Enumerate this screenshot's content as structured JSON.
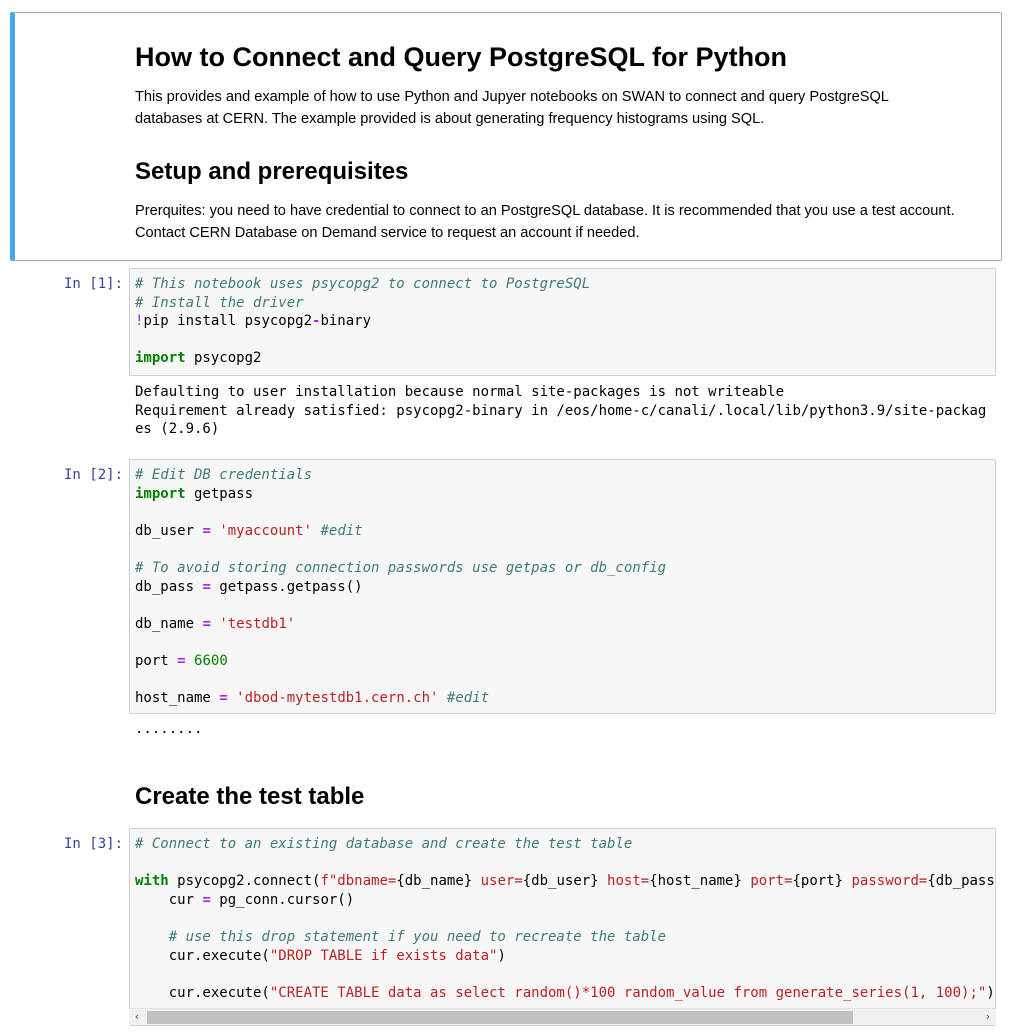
{
  "markdown": {
    "title": "How to Connect and Query PostgreSQL for Python",
    "intro": "This provides and example of how to use Python and Jupyer notebooks on SWAN to connect and query PostgreSQL databases at CERN. The example provided is about generating frequency histograms using SQL.",
    "setup_heading": "Setup and prerequisites",
    "setup_text": "Prerquites: you need to have credential to connect to an PostgreSQL database. It is recommended that you use a test account. Contact CERN Database on Demand service to request an account if needed."
  },
  "cells": {
    "cell1": {
      "prompt": "In [1]:",
      "line1": "# This notebook uses psycopg2 to connect to PostgreSQL",
      "line2": "# Install the driver",
      "line3_bang": "!",
      "line3_rest": "pip install psycopg2",
      "line3_minus": "-",
      "line3_end": "binary",
      "line5_kw": "import",
      "line5_rest": " psycopg2",
      "output": "Defaulting to user installation because normal site-packages is not writeable\nRequirement already satisfied: psycopg2-binary in /eos/home-c/canali/.local/lib/python3.9/site-packag\nes (2.9.6)"
    },
    "cell2": {
      "prompt": "In [2]:",
      "c1": "# Edit DB credentials",
      "import_kw": "import",
      "import_rest": " getpass",
      "db_user_name": "db_user ",
      "db_user_val": "'myaccount'",
      "db_user_comment": "#edit",
      "c2": "# To avoid storing connection passwords use getpas or db_config",
      "db_pass_name": "db_pass ",
      "db_pass_val": " getpass.getpass()",
      "db_name_name": "db_name ",
      "db_name_val": "'testdb1'",
      "port_name": "port ",
      "port_val": "6600",
      "host_name_name": "host_name ",
      "host_name_val": "'dbod-mytestdb1.cern.ch'",
      "host_comment": "#edit",
      "eq": "=",
      "output": "........"
    },
    "heading2": "Create the test table",
    "cell3": {
      "prompt": "In [3]:",
      "c1": "# Connect to an existing database and create the test table",
      "with_kw": "with",
      "with_rest1": " psycopg2.connect(",
      "with_f": "f",
      "with_s1": "\"dbname=",
      "with_v1": "{db_name}",
      "with_s2": " user=",
      "with_v2": "{db_user}",
      "with_s3": " host=",
      "with_v3": "{host_name}",
      "with_s4": " port=",
      "with_v4": "{port}",
      "with_s5": " password=",
      "with_v5": "{db_pass}",
      "cur_line_a": "    cur ",
      "eq": "=",
      "cur_line_b": " pg_conn.cursor()",
      "c2": "    # use this drop statement if you need to recreate the table",
      "exec1_a": "    cur.execute(",
      "exec1_s": "\"DROP TABLE if exists data\"",
      "exec1_b": ")",
      "exec2_a": "    cur.execute(",
      "exec2_s": "\"CREATE TABLE data as select random()*100 random_value from generate_series(1, 100);\"",
      "exec2_b": ")"
    }
  },
  "scrollbar": {
    "left_arrow": "‹",
    "right_arrow": "›",
    "position": 0.0
  },
  "colors": {
    "accent": "#42a5f5",
    "prompt": "#303f9f",
    "comment": "#3d7b7b",
    "keyword": "#008000",
    "string": "#ba2121",
    "operator": "#aa22ff"
  }
}
